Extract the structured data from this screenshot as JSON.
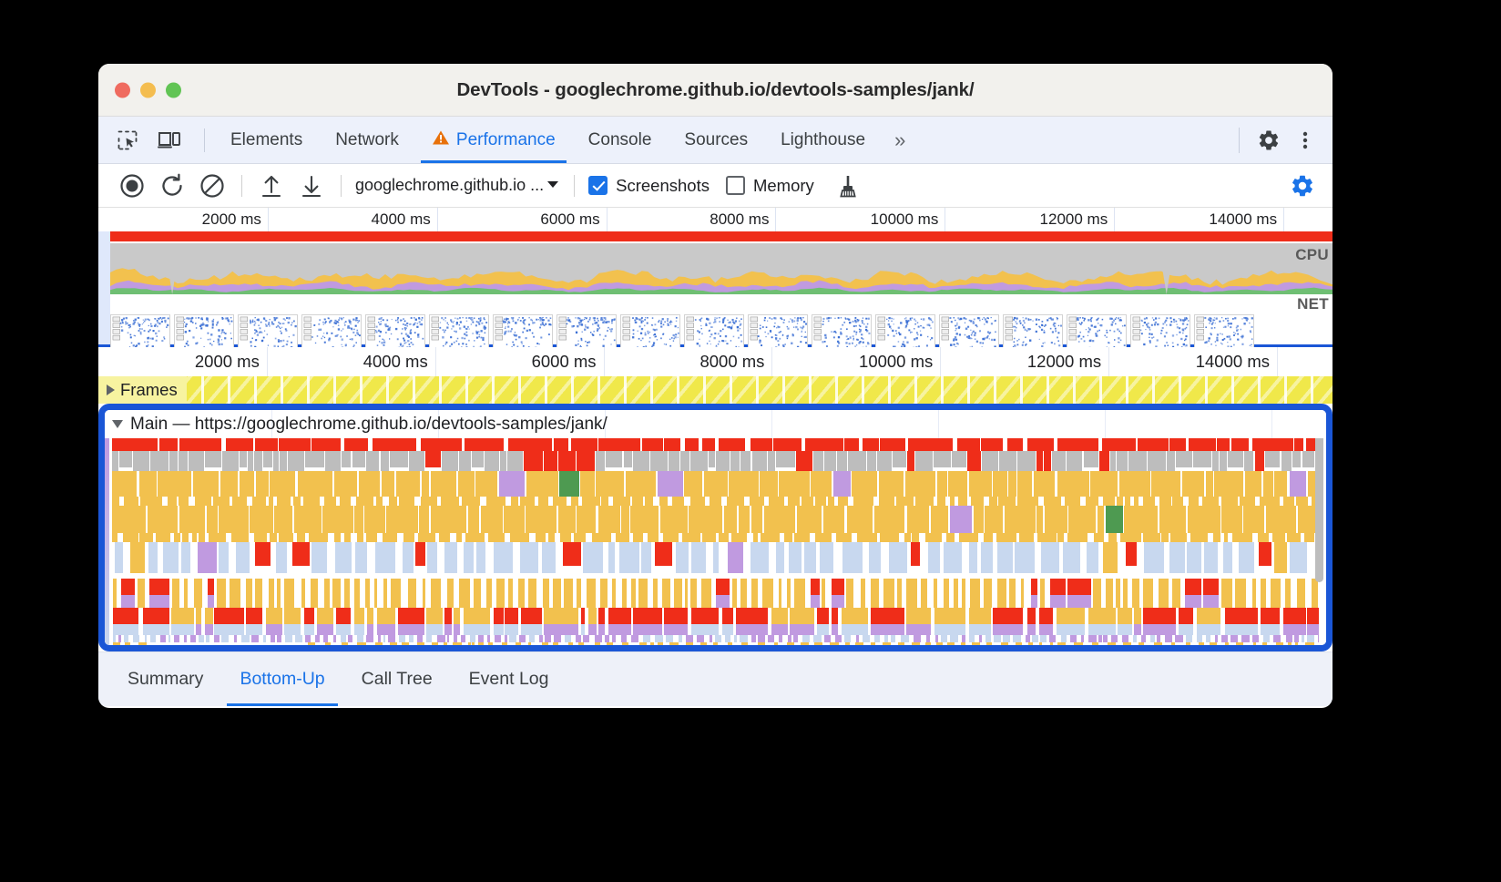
{
  "window": {
    "title": "DevTools - googlechrome.github.io/devtools-samples/jank/",
    "traffic": {
      "close": "close-button",
      "minimize": "minimize-button",
      "zoom": "zoom-button"
    }
  },
  "devtools_tabs": {
    "inspect_icon": "inspect-element-icon",
    "device_icon": "device-toolbar-icon",
    "overflow": "»",
    "settings_icon": "gear-icon",
    "more_icon": "more-options-icon",
    "items": [
      {
        "label": "Elements",
        "active": false,
        "warning": false
      },
      {
        "label": "Network",
        "active": false,
        "warning": false
      },
      {
        "label": "Performance",
        "active": true,
        "warning": true
      },
      {
        "label": "Console",
        "active": false,
        "warning": false
      },
      {
        "label": "Sources",
        "active": false,
        "warning": false
      },
      {
        "label": "Lighthouse",
        "active": false,
        "warning": false
      }
    ]
  },
  "performance_toolbar": {
    "record_icon": "record-icon",
    "reload_record_icon": "reload-and-record-icon",
    "clear_icon": "clear-recording-icon",
    "upload_icon": "upload-profile-icon",
    "download_icon": "download-profile-icon",
    "target_select": "googlechrome.github.io ...",
    "screenshots": {
      "label": "Screenshots",
      "checked": true
    },
    "memory": {
      "label": "Memory",
      "checked": false
    },
    "collect_garbage_icon": "collect-garbage-broom-icon",
    "capture_settings_icon": "capture-settings-gear-icon"
  },
  "overview": {
    "tick_labels": [
      "2000 ms",
      "4000 ms",
      "6000 ms",
      "8000 ms",
      "10000 ms",
      "12000 ms",
      "14000 ms"
    ],
    "tick_values_ms": [
      2000,
      4000,
      6000,
      8000,
      10000,
      12000,
      14000
    ],
    "cpu_label": "CPU",
    "net_label": "NET",
    "red_bar_color": "#ef2d19",
    "cpu_colors": {
      "scripting": "#f2c14e",
      "rendering": "#c09ae0",
      "painting": "#6fbf73",
      "idle": "#c9c9c9"
    }
  },
  "flame_ruler": {
    "tick_labels": [
      "2000 ms",
      "4000 ms",
      "6000 ms",
      "8000 ms",
      "10000 ms",
      "12000 ms",
      "14000 ms"
    ],
    "tick_values_ms": [
      2000,
      4000,
      6000,
      8000,
      10000,
      12000,
      14000
    ]
  },
  "tracks": {
    "frames": {
      "label": "Frames",
      "expanded": false,
      "arrow": "collapsed-arrow-icon"
    },
    "main": {
      "label": "Main — https://googlechrome.github.io/devtools-samples/jank/",
      "expanded": true,
      "arrow": "expanded-arrow-icon",
      "highlighted": true,
      "highlight_color": "#1a56d6"
    }
  },
  "bottom_tabs": {
    "items": [
      {
        "label": "Summary",
        "active": false
      },
      {
        "label": "Bottom-Up",
        "active": true
      },
      {
        "label": "Call Tree",
        "active": false
      },
      {
        "label": "Event Log",
        "active": false
      }
    ]
  },
  "colors": {
    "accent": "#1a73e8",
    "highlight": "#1a56d6",
    "long_task_red": "#ef2d19",
    "scripting_yellow": "#f2c14e",
    "loading_blue": "#c8d8ef",
    "rendering_purple": "#c09ae0",
    "painting_green": "#4e9a51",
    "system_gray": "#bdbdbd",
    "frames_yellow": "#f0e84a",
    "warning_orange": "#e8710a"
  }
}
